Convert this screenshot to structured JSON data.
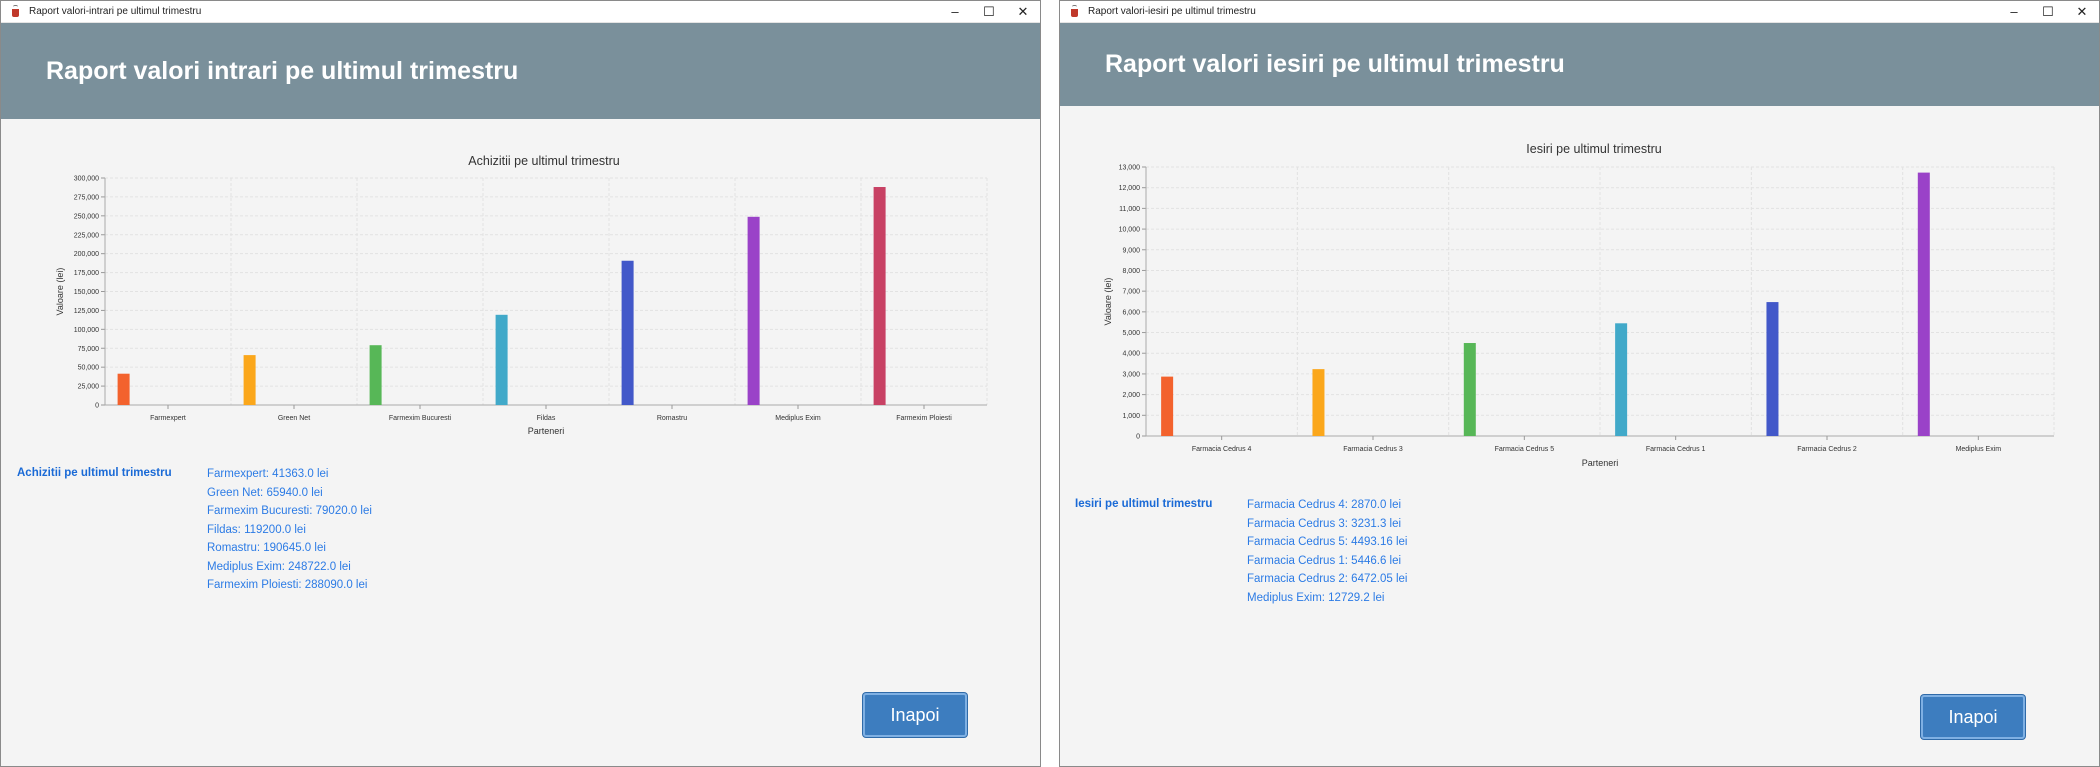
{
  "windows": [
    {
      "title": "Raport valori-intrari pe ultimul trimestru",
      "header": "Raport valori intrari pe ultimul trimestru",
      "summary_title": "Achizitii pe ultimul trimestru",
      "summary_lines": [
        "Farmexpert: 41363.0 lei",
        "Green Net: 65940.0 lei",
        "Farmexim Bucuresti: 79020.0 lei",
        "Fildas: 119200.0 lei",
        "Romastru: 190645.0 lei",
        "Mediplus Exim: 248722.0 lei",
        "Farmexim Ploiesti: 288090.0 lei"
      ],
      "back_label": "Inapoi",
      "chart_data": {
        "type": "bar",
        "title": "Achizitii pe ultimul trimestru",
        "xlabel": "Parteneri",
        "ylabel": "Valoare (lei)",
        "categories": [
          "Farmexpert",
          "Green Net",
          "Farmexim Bucuresti",
          "Fildas",
          "Romastru",
          "Mediplus Exim",
          "Farmexim Ploiesti"
        ],
        "values": [
          41363.0,
          65940.0,
          79020.0,
          119200.0,
          190645.0,
          248722.0,
          288090.0
        ],
        "colors": [
          "#f3622d",
          "#fba71b",
          "#57b757",
          "#41a9c9",
          "#4258c9",
          "#9a42c8",
          "#c84164"
        ],
        "ylim": [
          0,
          300000
        ],
        "yticks": [
          0,
          25000,
          50000,
          75000,
          100000,
          125000,
          150000,
          175000,
          200000,
          225000,
          250000,
          275000,
          300000
        ],
        "ytick_labels": [
          "0",
          "25,000",
          "50,000",
          "75,000",
          "100,000",
          "125,000",
          "150,000",
          "175,000",
          "200,000",
          "225,000",
          "250,000",
          "275,000",
          "300,000"
        ],
        "grid": true
      }
    },
    {
      "title": "Raport valori-iesiri pe ultimul trimestru",
      "header": "Raport valori iesiri pe ultimul trimestru",
      "summary_title": "Iesiri pe ultimul trimestru",
      "summary_lines": [
        "Farmacia Cedrus 4: 2870.0 lei",
        "Farmacia Cedrus 3: 3231.3 lei",
        "Farmacia Cedrus 5: 4493.16 lei",
        "Farmacia Cedrus 1: 5446.6 lei",
        "Farmacia Cedrus 2: 6472.05 lei",
        "Mediplus Exim: 12729.2 lei"
      ],
      "back_label": "Inapoi",
      "chart_data": {
        "type": "bar",
        "title": "Iesiri pe ultimul trimestru",
        "xlabel": "Parteneri",
        "ylabel": "Valoare (lei)",
        "categories": [
          "Farmacia Cedrus 4",
          "Farmacia Cedrus 3",
          "Farmacia Cedrus 5",
          "Farmacia Cedrus 1",
          "Farmacia Cedrus 2",
          "Mediplus Exim"
        ],
        "values": [
          2870.0,
          3231.3,
          4493.16,
          5446.6,
          6472.05,
          12729.2
        ],
        "colors": [
          "#f3622d",
          "#fba71b",
          "#57b757",
          "#41a9c9",
          "#4258c9",
          "#9a42c8"
        ],
        "ylim": [
          0,
          13000
        ],
        "yticks": [
          0,
          1000,
          2000,
          3000,
          4000,
          5000,
          6000,
          7000,
          8000,
          9000,
          10000,
          11000,
          12000,
          13000
        ],
        "ytick_labels": [
          "0",
          "1,000",
          "2,000",
          "3,000",
          "4,000",
          "5,000",
          "6,000",
          "7,000",
          "8,000",
          "9,000",
          "10,000",
          "11,000",
          "12,000",
          "13,000"
        ],
        "grid": true
      }
    }
  ]
}
